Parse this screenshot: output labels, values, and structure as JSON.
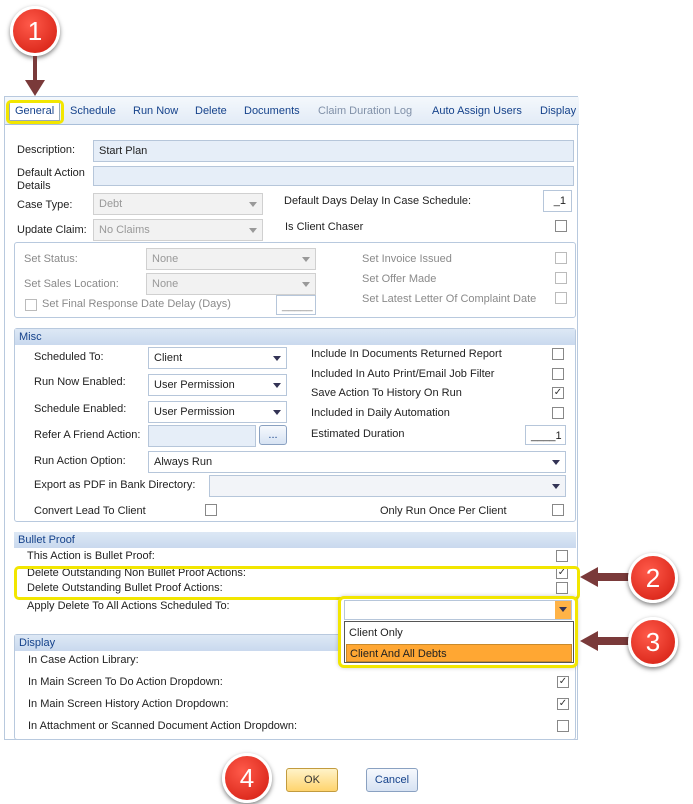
{
  "tabs": [
    {
      "label": "General"
    },
    {
      "label": "Schedule"
    },
    {
      "label": "Run Now"
    },
    {
      "label": "Delete"
    },
    {
      "label": "Documents"
    },
    {
      "label": "Claim Duration Log"
    },
    {
      "label": "Auto Assign Users"
    },
    {
      "label": "Display"
    }
  ],
  "general": {
    "description_label": "Description:",
    "description_value": "Start Plan",
    "default_action_details_label": "Default Action Details",
    "case_type_label": "Case Type:",
    "case_type_value": "Debt",
    "default_days_delay_label": "Default Days Delay In Case Schedule:",
    "default_days_delay_value": "_1",
    "update_claim_label": "Update Claim:",
    "update_claim_value": "No Claims",
    "is_client_chaser_label": "Is Client Chaser",
    "set_status_label": "Set Status:",
    "set_status_value": "None",
    "set_sales_location_label": "Set Sales Location:",
    "set_sales_location_value": "None",
    "set_final_response_label": "Set Final Response Date Delay (Days)",
    "set_final_response_value": "_____",
    "set_invoice_issued_label": "Set Invoice Issued",
    "set_offer_made_label": "Set Offer Made",
    "set_latest_letter_label": "Set Latest Letter Of Complaint Date"
  },
  "misc": {
    "title": "Misc",
    "scheduled_to_label": "Scheduled To:",
    "scheduled_to_value": "Client",
    "run_now_enabled_label": "Run Now Enabled:",
    "run_now_enabled_value": "User Permission",
    "schedule_enabled_label": "Schedule Enabled:",
    "schedule_enabled_value": "User Permission",
    "refer_friend_label": "Refer A Friend Action:",
    "refer_friend_button": "...",
    "run_action_option_label": "Run Action Option:",
    "run_action_option_value": "Always Run",
    "export_pdf_label": "Export as PDF in Bank Directory:",
    "convert_lead_label": "Convert Lead To Client",
    "include_docs_returned_label": "Include In Documents Returned Report",
    "included_auto_print_label": "Included In Auto Print/Email Job Filter",
    "save_action_history_label": "Save Action To History On Run",
    "included_daily_auto_label": "Included in Daily Automation",
    "estimated_duration_label": "Estimated Duration",
    "estimated_duration_value": "____1",
    "only_run_once_label": "Only Run Once Per Client"
  },
  "bullet_proof": {
    "title": "Bullet Proof",
    "this_action_label": "This Action is Bullet Proof:",
    "delete_non_label": "Delete Outstanding Non Bullet Proof Actions:",
    "delete_bp_label": "Delete Outstanding Bullet Proof Actions:",
    "apply_delete_label": "Apply Delete To All Actions Scheduled To:",
    "apply_delete_value": "",
    "options": [
      "Client Only",
      "Client And All Debts"
    ]
  },
  "display": {
    "title": "Display",
    "case_library_label": "In Case Action Library:",
    "todo_dropdown_label": "In Main Screen To Do Action Dropdown:",
    "history_dropdown_label": "In Main Screen History Action Dropdown:",
    "attachment_dropdown_label": "In Attachment or Scanned Document Action Dropdown:"
  },
  "buttons": {
    "ok": "OK",
    "cancel": "Cancel"
  },
  "callouts": [
    "1",
    "2",
    "3",
    "4"
  ],
  "checks": {
    "mark": "✓"
  },
  "colors": {
    "accent": "#15428b",
    "highlight": "#f2e600",
    "callout": "#d11a0e",
    "selected_option": "#ffa733"
  }
}
